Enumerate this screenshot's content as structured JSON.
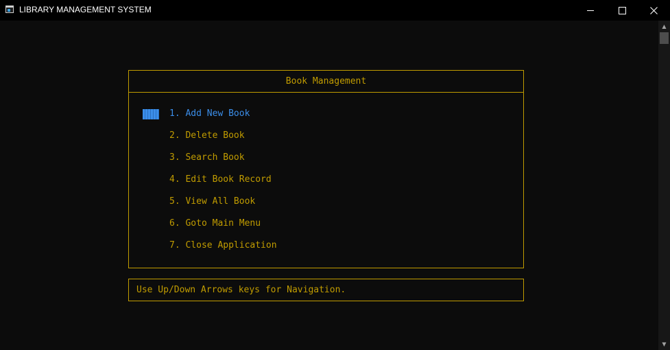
{
  "window": {
    "title": "LIBRARY MANAGEMENT SYSTEM",
    "controls": {
      "minimize": "minimize-icon",
      "maximize": "maximize-icon",
      "close": "close-icon"
    }
  },
  "menu": {
    "header": "Book Management",
    "selected_index": 0,
    "items": [
      {
        "label": "1. Add New Book"
      },
      {
        "label": "2. Delete Book"
      },
      {
        "label": "3. Search Book"
      },
      {
        "label": "4. Edit Book Record"
      },
      {
        "label": "5. View All Book"
      },
      {
        "label": "6. Goto Main Menu"
      },
      {
        "label": "7. Close Application"
      }
    ]
  },
  "status": {
    "hint": "Use Up/Down Arrows keys for Navigation."
  },
  "colors": {
    "background": "#0c0c0c",
    "text": "#c19c00",
    "border": "#c19c00",
    "selected": "#3b8eea",
    "titlebar": "#000000"
  }
}
